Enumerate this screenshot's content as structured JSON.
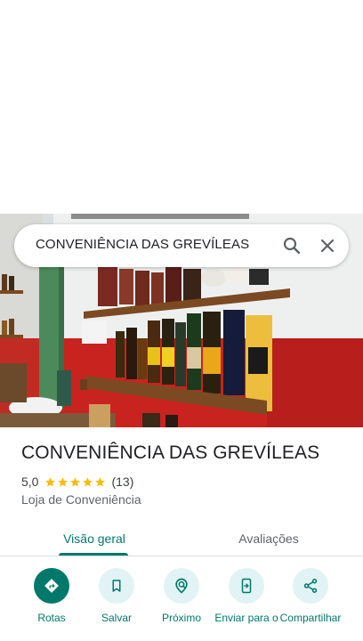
{
  "search": {
    "query": "CONVENIÊNCIA DAS GREVÍLEAS"
  },
  "place": {
    "title": "CONVENIÊNCIA DAS GREVÍLEAS",
    "rating": "5,0",
    "stars": 5,
    "review_count": "(13)",
    "category": "Loja de Conveniência"
  },
  "tabs": [
    {
      "label": "Visão geral",
      "active": true
    },
    {
      "label": "Avaliações",
      "active": false
    }
  ],
  "actions": [
    {
      "label": "Rotas",
      "icon": "directions-icon"
    },
    {
      "label": "Salvar",
      "icon": "bookmark-icon"
    },
    {
      "label": "Próximo",
      "icon": "nearby-icon"
    },
    {
      "label": "Enviar para o",
      "icon": "send-to-phone-icon"
    },
    {
      "label": "Compartilhar",
      "icon": "share-icon"
    }
  ],
  "colors": {
    "accent": "#00796b",
    "action_bg": "#e1f3f5",
    "star": "#fbbc04"
  }
}
